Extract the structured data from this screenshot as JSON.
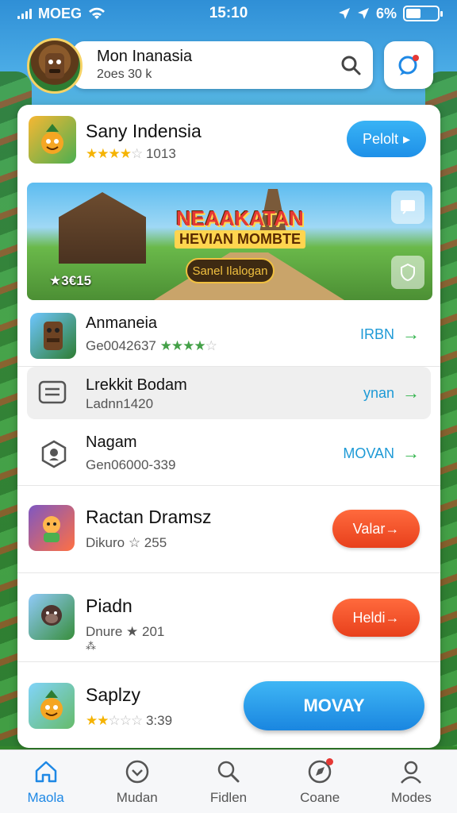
{
  "status_bar": {
    "carrier": "MOEG",
    "time": "15:10",
    "battery": "6%"
  },
  "header": {
    "title": "Mon Inanasia",
    "subtitle": "2oes 30 k"
  },
  "featured": {
    "title": "Sany Indensia",
    "rating_count": "1013",
    "stars": 4,
    "button_label": "Pelolt"
  },
  "banner": {
    "title": "NEAAKATAN",
    "subtitle": "HEVIAN MOMBTE",
    "button_label": "Sanel Ilalogan",
    "badge": "★3€15"
  },
  "list_items": [
    {
      "title": "Anmaneia",
      "meta": "Ge0042637",
      "stars": 4,
      "action": "IRBN"
    },
    {
      "title": "Lrekkit Bodam",
      "meta": "Ladnn1420",
      "action": "ynan"
    },
    {
      "title": "Nagam",
      "meta": "Gen06000-339",
      "action": "MOVAN"
    }
  ],
  "games": [
    {
      "title": "Ractan Dramsz",
      "meta": "Dikuro ☆ 255",
      "button_label": "Valar"
    },
    {
      "title": "Piadn",
      "meta": "Dnure ★ 201",
      "meta2": "⁂",
      "button_label": "Heldi"
    },
    {
      "title": "Saplzy",
      "meta": "3:39",
      "stars": 2,
      "button_label": "MOVAY"
    }
  ],
  "bottom_nav": [
    {
      "label": "Maola",
      "active": true
    },
    {
      "label": "Mudan"
    },
    {
      "label": "Fidlen"
    },
    {
      "label": "Coane",
      "badge": true
    },
    {
      "label": "Modes"
    }
  ],
  "colors": {
    "accent_blue": "#1e90e8",
    "accent_orange": "#e8401c",
    "accent_green": "#2fb34a"
  }
}
